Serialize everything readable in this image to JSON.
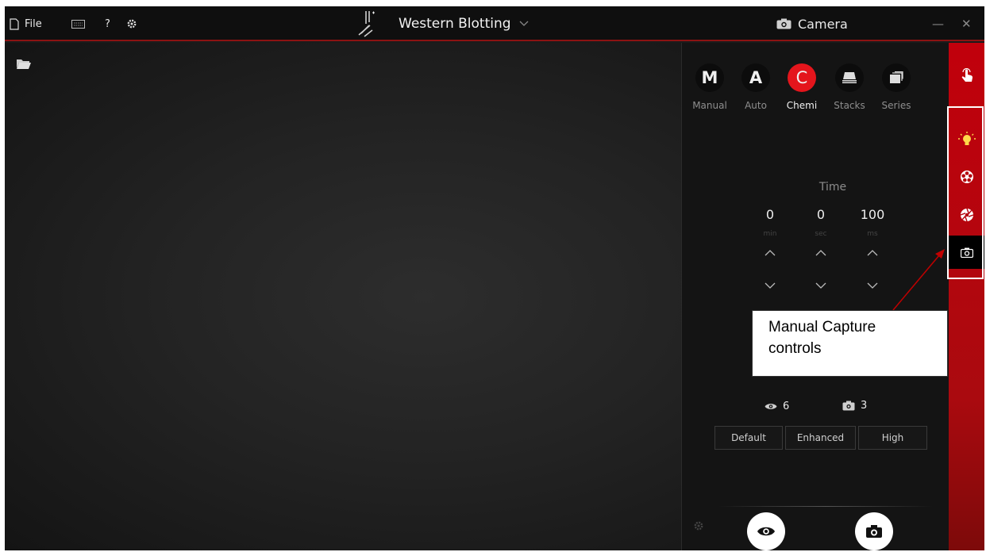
{
  "titlebar": {
    "file_label": "File",
    "help_label": "?",
    "title": "Western Blotting",
    "camera_label": "Camera",
    "minimize_label": "—",
    "close_label": "✕"
  },
  "modes": [
    {
      "letter": "M",
      "label": "Manual"
    },
    {
      "letter": "A",
      "label": "Auto"
    },
    {
      "letter": "C",
      "label": "Chemi",
      "active": true
    },
    {
      "letter": "",
      "label": "Stacks",
      "icon": "stacks-icon"
    },
    {
      "letter": "",
      "label": "Series",
      "icon": "series-icon"
    }
  ],
  "time": {
    "label": "Time",
    "min": {
      "value": "0",
      "unit": "min"
    },
    "sec": {
      "value": "0",
      "unit": "sec"
    },
    "ms": {
      "value": "100",
      "unit": "ms"
    }
  },
  "counts": {
    "preview": "6",
    "capture": "3"
  },
  "quality": {
    "default": "Default",
    "enhanced": "Enhanced",
    "high": "High"
  },
  "sidebar_icons": [
    "hand-touch-icon",
    "lightbulb-icon",
    "filter-wheel-icon",
    "aperture-icon",
    "camera-icon"
  ],
  "callout": {
    "line1": "Manual Capture",
    "line2": "controls"
  },
  "colors": {
    "accent": "#e4151c",
    "sidebar": "#b3000c",
    "titlebar_border": "#8c1212"
  }
}
